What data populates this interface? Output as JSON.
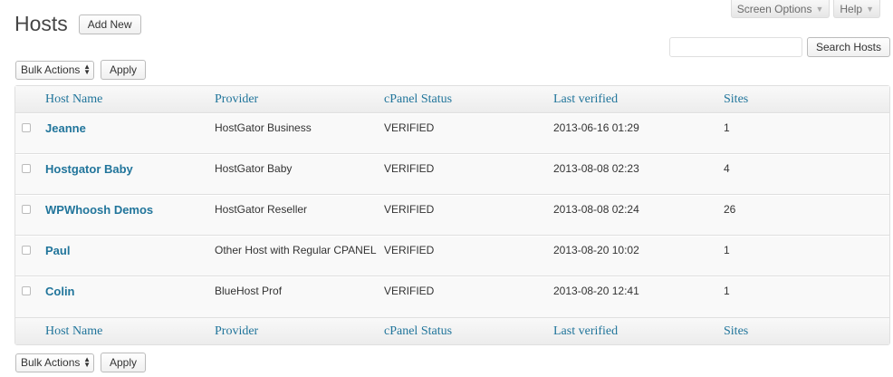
{
  "screen_meta": {
    "screen_options_label": "Screen Options",
    "help_label": "Help"
  },
  "header": {
    "title": "Hosts",
    "add_new_label": "Add New"
  },
  "search": {
    "value": "",
    "placeholder": "",
    "button_label": "Search Hosts"
  },
  "bulk_actions": {
    "selected": "Bulk Actions",
    "apply_label": "Apply"
  },
  "table": {
    "columns": [
      "Host Name",
      "Provider",
      "cPanel Status",
      "Last verified",
      "Sites"
    ],
    "rows": [
      {
        "name": "Jeanne",
        "provider": "HostGator Business",
        "status": "VERIFIED",
        "last_verified": "2013-06-16 01:29",
        "sites": "1"
      },
      {
        "name": "Hostgator Baby",
        "provider": "HostGator Baby",
        "status": "VERIFIED",
        "last_verified": "2013-08-08 02:23",
        "sites": "4"
      },
      {
        "name": "WPWhoosh Demos",
        "provider": "HostGator Reseller",
        "status": "VERIFIED",
        "last_verified": "2013-08-08 02:24",
        "sites": "26"
      },
      {
        "name": "Paul",
        "provider": "Other Host with Regular CPANEL",
        "status": "VERIFIED",
        "last_verified": "2013-08-20 10:02",
        "sites": "1"
      },
      {
        "name": "Colin",
        "provider": "BlueHost Prof",
        "status": "VERIFIED",
        "last_verified": "2013-08-20 12:41",
        "sites": "1"
      }
    ]
  },
  "colors": {
    "link": "#21759b",
    "border": "#dfdfdf",
    "row_bg": "#f9f9f9"
  }
}
